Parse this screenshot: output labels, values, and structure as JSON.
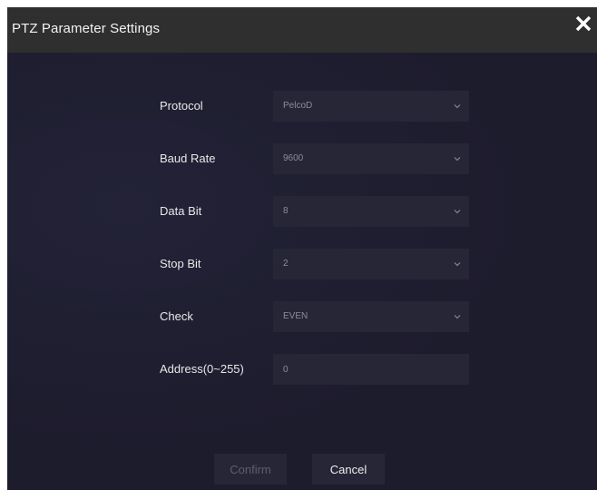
{
  "dialog": {
    "title": "PTZ Parameter Settings",
    "close_icon": "close-x-icon"
  },
  "fields": [
    {
      "label": "Protocol",
      "value": "PelcoD",
      "type": "select"
    },
    {
      "label": "Baud Rate",
      "value": "9600",
      "type": "select"
    },
    {
      "label": "Data Bit",
      "value": "8",
      "type": "select"
    },
    {
      "label": "Stop Bit",
      "value": "2",
      "type": "select"
    },
    {
      "label": "Check",
      "value": "EVEN",
      "type": "select"
    },
    {
      "label": "Address(0~255)",
      "value": "0",
      "type": "input"
    }
  ],
  "buttons": {
    "confirm": "Confirm",
    "cancel": "Cancel"
  },
  "colors": {
    "dialog_bg": "#1d1c2d",
    "header_bg": "#2f2f2f",
    "control_bg": "#262637",
    "label_text": "#e8e8e8",
    "value_text": "#8c8c99",
    "disabled_text": "#5e5e6c"
  }
}
